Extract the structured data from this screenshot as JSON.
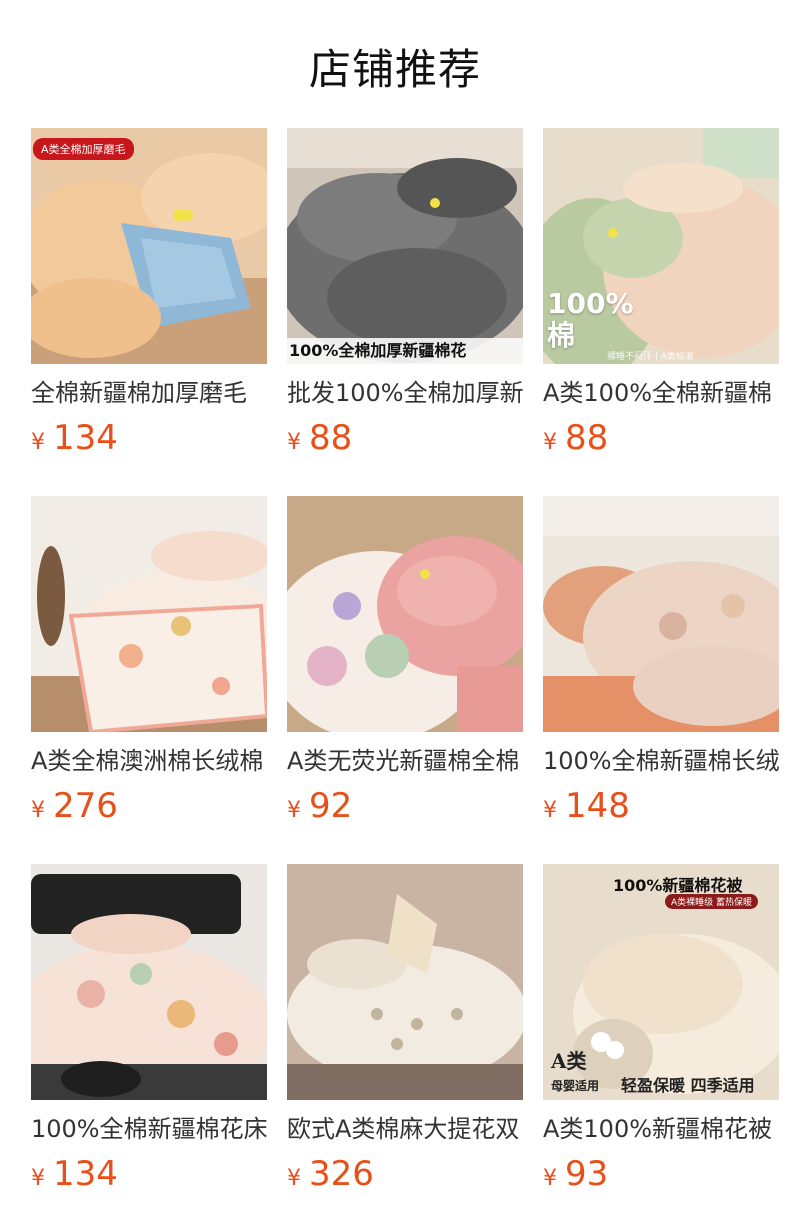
{
  "page": {
    "title": "店铺推荐"
  },
  "products": [
    {
      "name": "全棉新疆棉加厚磨毛",
      "currency": "¥",
      "price": "134",
      "overlay": {
        "badge": "A类全棉加厚磨毛"
      }
    },
    {
      "name": "批发100%全棉加厚新",
      "currency": "¥",
      "price": "88",
      "overlay": {
        "strip": "100%全棉加厚新疆棉花"
      }
    },
    {
      "name": "A类100%全棉新疆棉",
      "currency": "¥",
      "price": "88",
      "overlay": {
        "big": "100%",
        "big2": "棉",
        "note": "裸睡不闷汗 | A类标准"
      }
    },
    {
      "name": "A类全棉澳洲棉长绒棉",
      "currency": "¥",
      "price": "276"
    },
    {
      "name": "A类无荧光新疆棉全棉",
      "currency": "¥",
      "price": "92"
    },
    {
      "name": "100%全棉新疆棉长绒",
      "currency": "¥",
      "price": "148"
    },
    {
      "name": "100%全棉新疆棉花床",
      "currency": "¥",
      "price": "134"
    },
    {
      "name": "欧式A类棉麻大提花双",
      "currency": "¥",
      "price": "326"
    },
    {
      "name": "A类100%新疆棉花被",
      "currency": "¥",
      "price": "93",
      "overlay": {
        "top": "100%新疆棉花被",
        "sub": "A类裸睡级 蓄热保暖",
        "a": "A类",
        "aa": "母婴适用",
        "bottom": "轻盈保暖 四季适用"
      }
    }
  ]
}
